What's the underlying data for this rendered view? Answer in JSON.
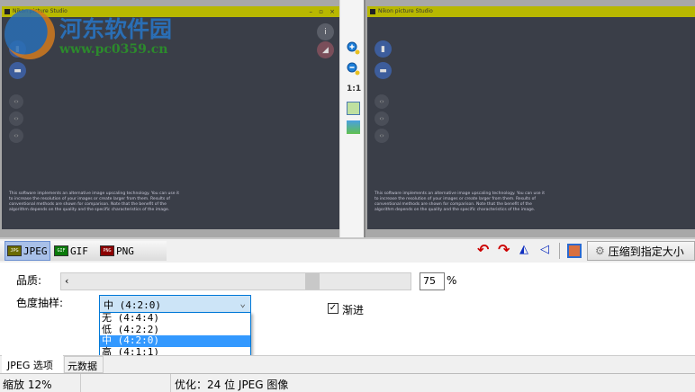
{
  "left_preview": {
    "title": "Nikon picture Studio",
    "desc": "This software implements an alternative image upscaling technology. You can use it to increase the resolution of your images or create larger from them. Results of conventional methods are shown for comparison. Note that the benefit of the algorithm depends on the quality and the specific characteristics of the image."
  },
  "right_preview": {
    "title": "Nikon picture Studio",
    "desc": "This software implements an alternative image upscaling technology. You can use it to increase the resolution of your images or create larger from them. Results of conventional methods are shown for comparison. Note that the benefit of the algorithm depends on the quality and the specific characteristics of the image."
  },
  "watermark": {
    "name": "河东软件园",
    "url": "www.pc0359.cn"
  },
  "mid_toolbar": {
    "zoom_in": "zoom-in",
    "zoom_out": "zoom-out",
    "actual_size": "1:1"
  },
  "formats": [
    {
      "icon": "JPG",
      "label": "JPEG",
      "color": "#6b6b00"
    },
    {
      "icon": "GIF",
      "label": "GIF",
      "color": "#0a7a0a"
    },
    {
      "icon": "PNG",
      "label": "PNG",
      "color": "#8b0000"
    }
  ],
  "compress_button": "压缩到指定大小",
  "quality": {
    "label": "品质:",
    "value": "75",
    "unit": "%"
  },
  "chroma": {
    "label": "色度抽样:",
    "selected": "中 (4:2:0)",
    "options": [
      "无 (4:4:4)",
      "低 (4:2:2)",
      "中 (4:2:0)",
      "高 (4:1:1)"
    ]
  },
  "progressive": {
    "label": "渐进",
    "checked": true
  },
  "tabs": [
    "JPEG 选项",
    "元数据"
  ],
  "status": {
    "zoom": "缩放 12%",
    "info": "优化：24 位 JPEG 图像"
  }
}
